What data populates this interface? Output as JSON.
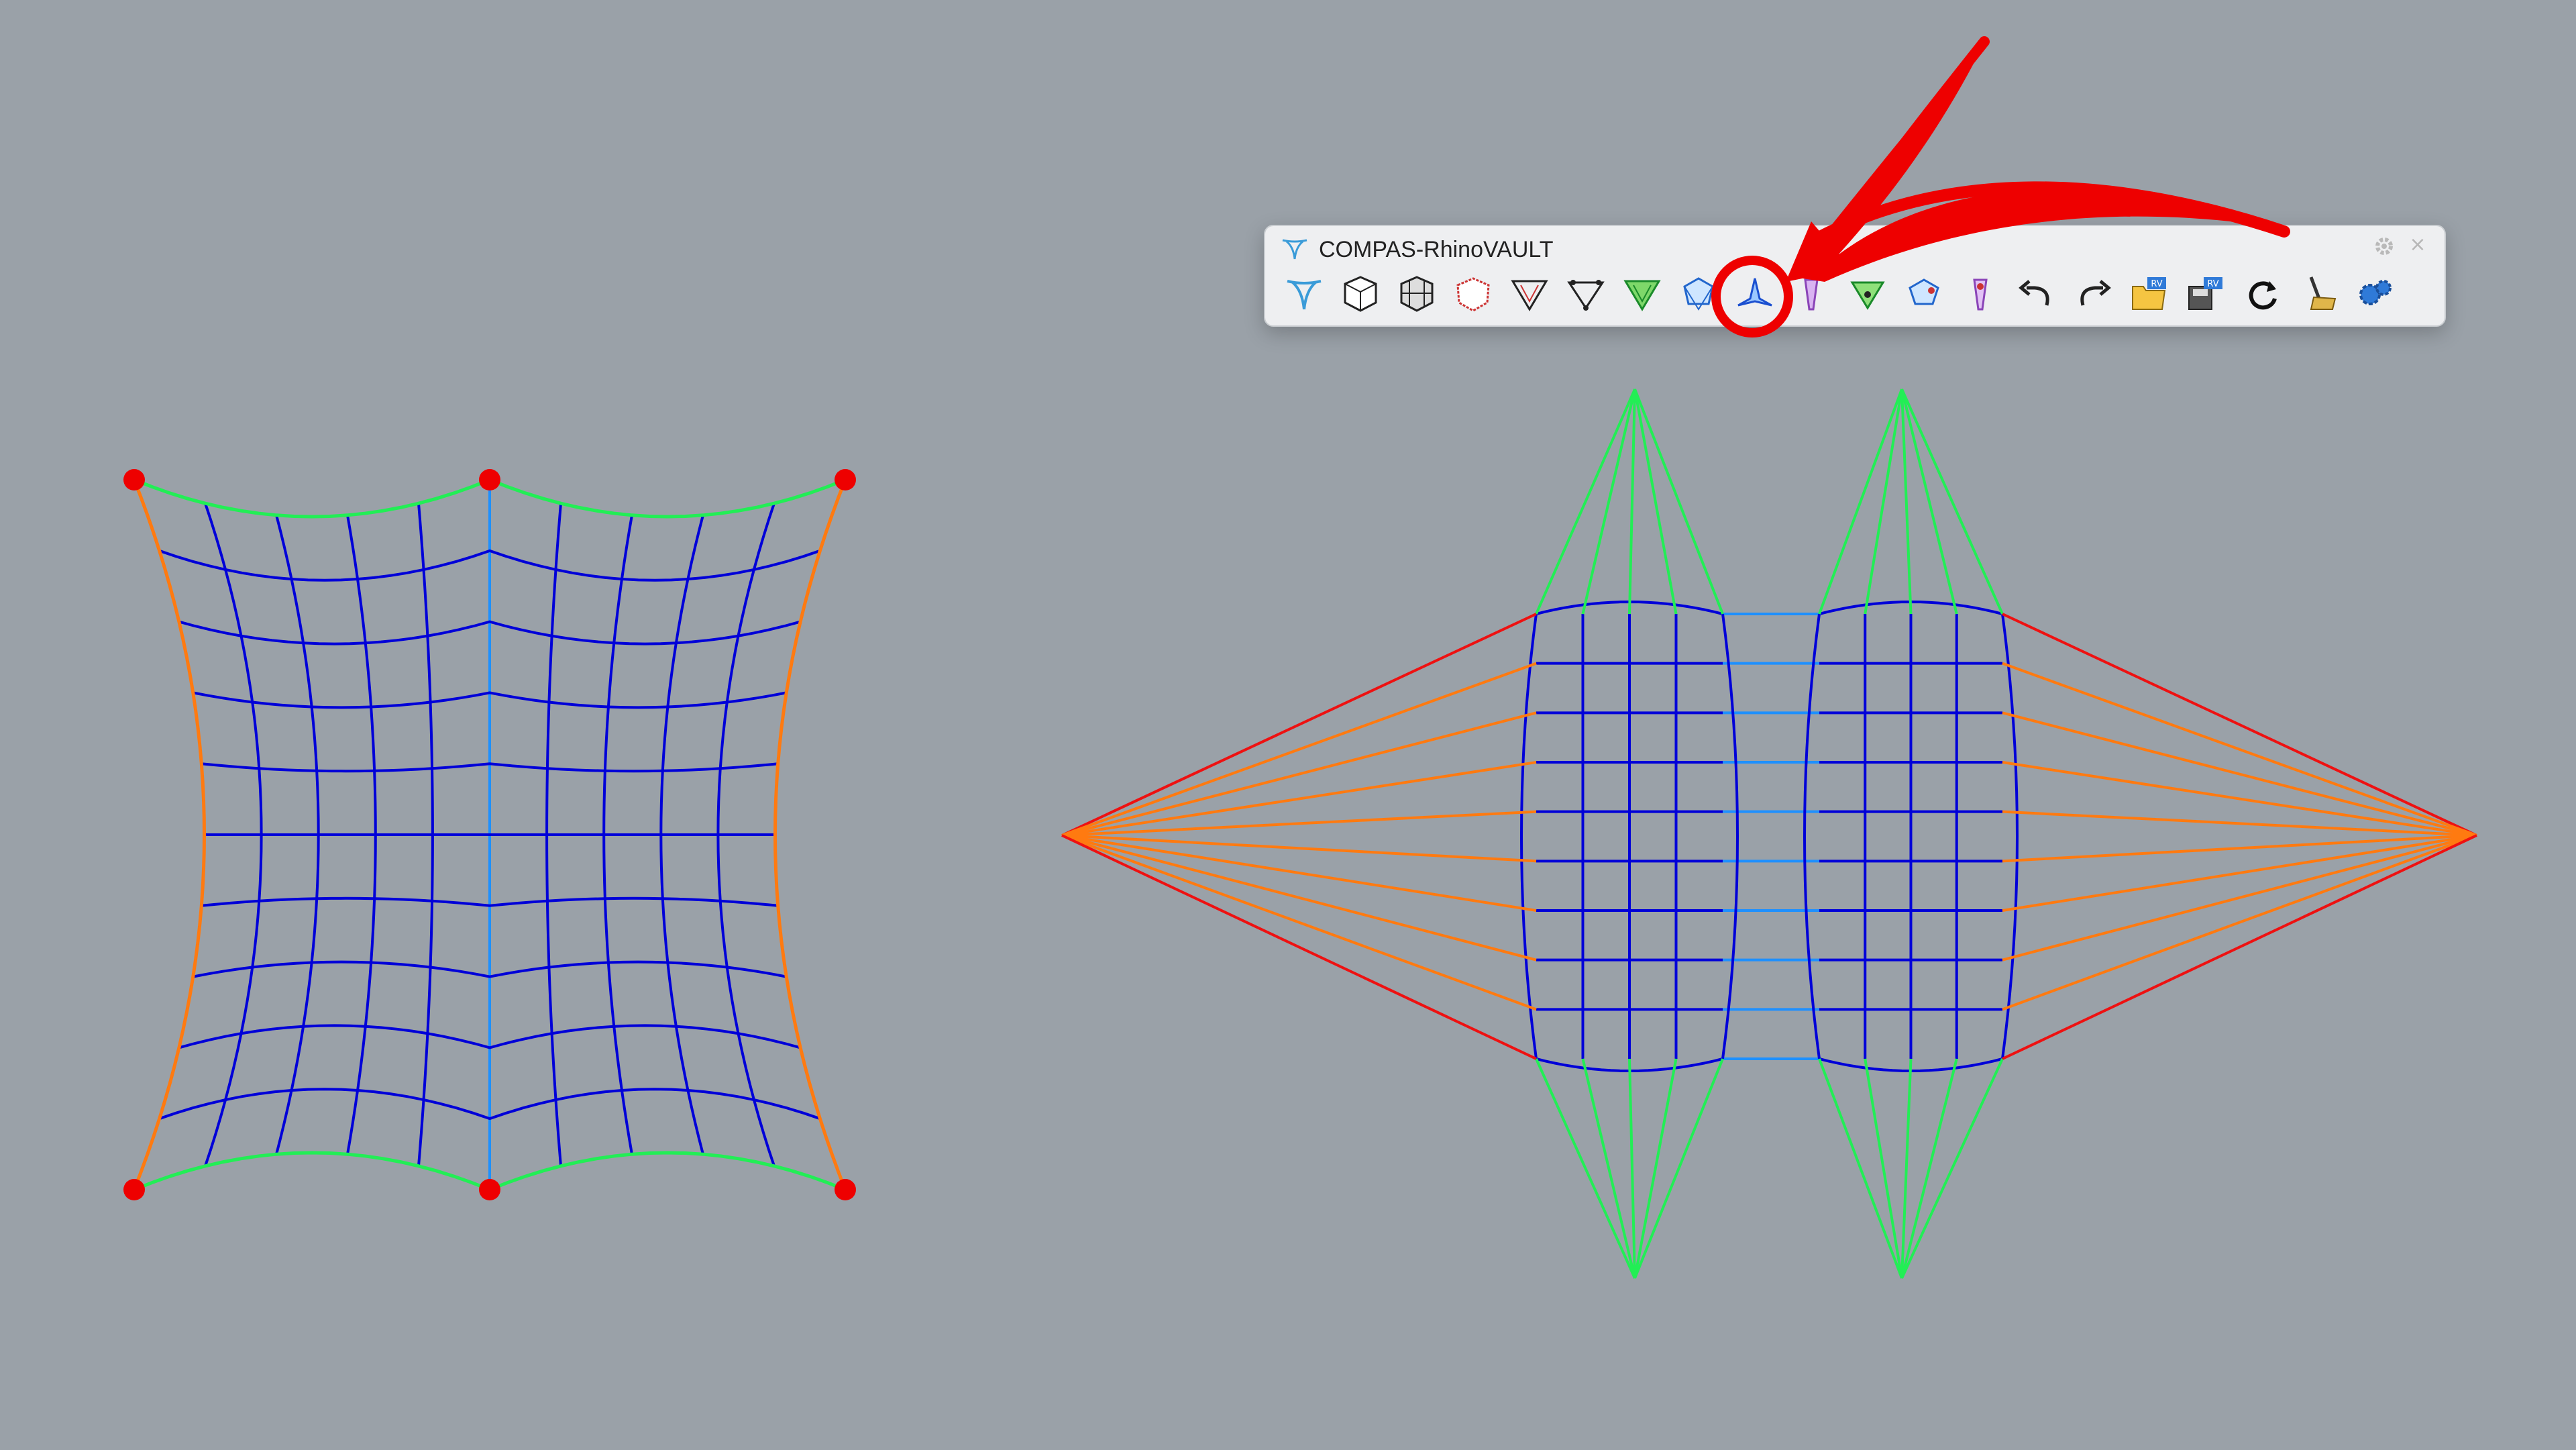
{
  "toolbar": {
    "title": "COMPAS-RhinoVAULT",
    "close_glyph": "×",
    "gear_icon": "gear-icon",
    "buttons": [
      {
        "icon": "rhinovault-logo-icon"
      },
      {
        "icon": "form-from-surface-icon"
      },
      {
        "icon": "form-from-mesh-icon"
      },
      {
        "icon": "form-pattern-icon"
      },
      {
        "icon": "form-boundary-icon"
      },
      {
        "icon": "form-supports-icon"
      },
      {
        "icon": "form-diagram-icon"
      },
      {
        "icon": "force-diagram-icon"
      },
      {
        "icon": "horizontal-equilibrium-icon"
      },
      {
        "icon": "vertical-equilibrium-icon"
      },
      {
        "icon": "modify-form-icon"
      },
      {
        "icon": "modify-force-icon"
      },
      {
        "icon": "modify-thrust-icon"
      },
      {
        "icon": "undo-icon"
      },
      {
        "icon": "redo-icon"
      },
      {
        "icon": "open-session-icon"
      },
      {
        "icon": "save-session-icon"
      },
      {
        "icon": "reload-icon"
      },
      {
        "icon": "clear-icon"
      },
      {
        "icon": "settings-icon"
      }
    ]
  },
  "colors": {
    "background": "#9aa1a8",
    "form_mesh": "#0000d8",
    "center_line": "#1e90ff",
    "green_edge": "#22ee55",
    "red_edge": "#ee1111",
    "orange_edge": "#ff7a10",
    "support_point": "#ee0000",
    "annotation": "#ee0000"
  }
}
